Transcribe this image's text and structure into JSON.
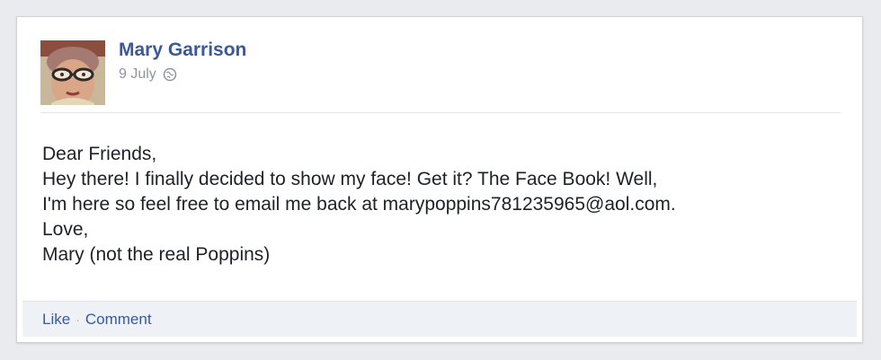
{
  "post": {
    "author": "Mary Garrison",
    "date": "9 July",
    "privacy_icon": "globe-icon",
    "message_lines": [
      "Dear Friends,",
      "Hey there! I finally decided to show my face! Get it? The Face Book! Well,",
      "I'm here so feel free to email me back at marypoppins781235965@aol.com.",
      "Love,",
      "Mary (not the real Poppins)"
    ]
  },
  "actions": {
    "like_label": "Like",
    "separator": "·",
    "comment_label": "Comment"
  },
  "colors": {
    "author_blue": "#3b5998",
    "background": "#e9ebee",
    "action_bar": "#eef1f6"
  }
}
